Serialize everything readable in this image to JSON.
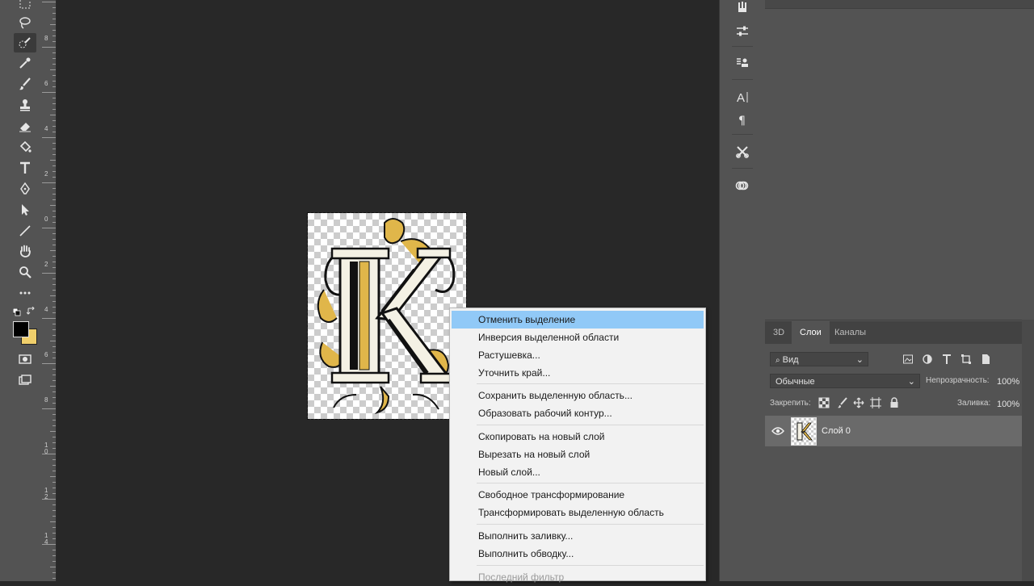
{
  "toolbar": {
    "tools": [
      "marquee-tool",
      "lasso-tool",
      "quick-selection-tool",
      "eyedropper-tool",
      "brush-tool",
      "clone-stamp-tool",
      "eraser-tool",
      "paint-bucket-tool",
      "type-tool",
      "pen-tool",
      "path-selection-tool",
      "line-tool",
      "hand-tool",
      "zoom-tool",
      "more-tools",
      "default-colors",
      "swap-colors",
      "foreground-color",
      "background-color",
      "quick-mask",
      "screen-mode"
    ],
    "foreground_color": "#000000",
    "background_color": "#f0cf6b"
  },
  "ruler": {
    "numbers": [
      "8",
      "6",
      "4",
      "2",
      "0",
      "2",
      "4",
      "6",
      "8",
      "1\n0",
      "1\n2",
      "1\n4"
    ]
  },
  "canvas": {
    "layer_letter": "K"
  },
  "layers_panel": {
    "tabs": [
      {
        "label": "3D"
      },
      {
        "label": "Слои"
      },
      {
        "label": "Каналы"
      }
    ],
    "filter_label": "Вид",
    "blend_mode": "Обычные",
    "opacity_label": "Непрозрачность:",
    "opacity_value": "100%",
    "lock_label": "Закрепить:",
    "fill_label": "Заливка:",
    "fill_value": "100%",
    "layer_name": "Слой 0"
  },
  "context_menu": {
    "items": [
      {
        "label": "Отменить выделение"
      },
      {
        "label": "Инверсия выделенной области"
      },
      {
        "label": "Растушевка..."
      },
      {
        "label": "Уточнить край..."
      },
      {
        "label": "Сохранить выделенную область..."
      },
      {
        "label": "Образовать рабочий контур..."
      },
      {
        "label": "Скопировать на новый слой"
      },
      {
        "label": "Вырезать на новый слой"
      },
      {
        "label": "Новый слой..."
      },
      {
        "label": "Свободное трансформирование"
      },
      {
        "label": "Трансформировать выделенную область"
      },
      {
        "label": "Выполнить заливку..."
      },
      {
        "label": "Выполнить обводку..."
      },
      {
        "label": "Последний фильтр"
      }
    ]
  }
}
